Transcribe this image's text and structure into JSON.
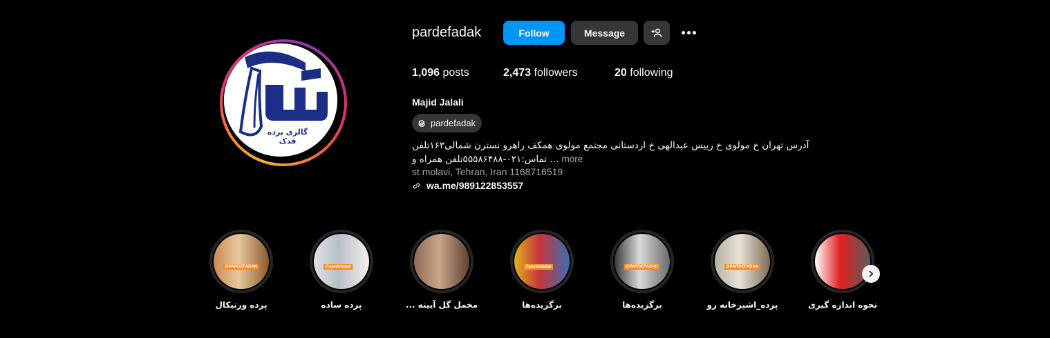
{
  "profile": {
    "username": "pardefadak",
    "logo_caption": "گالری پرده فدک",
    "follow_label": "Follow",
    "message_label": "Message",
    "stats": {
      "posts_count": "1,096",
      "posts_label": "posts",
      "followers_count": "2,473",
      "followers_label": "followers",
      "following_count": "20",
      "following_label": "following"
    },
    "full_name": "Majid Jalali",
    "threads_handle": "pardefadak",
    "bio_line1": "آدرس تهران خ مولوی خ رییس عبدالهی خ اردستانی مجتمع مولوی همکف راهرو نسترن شمالی۱۶۳تلفن",
    "bio_line2": "تماس:۰۲۱-۵۵۵۸۶۴۸۸تلفن همراه و ...",
    "more_label": "more",
    "address": "st molavi, Tehran, Iran 1168716519",
    "link": "wa.me/989122853557"
  },
  "highlights": [
    {
      "label": "پرده ورتیکال",
      "tag": "@PARDEFADAK",
      "colors": [
        "#c98a4e",
        "#e7c9a1",
        "#8b5a2b"
      ]
    },
    {
      "label": "پرده ساده",
      "tag": "@pardefadak",
      "colors": [
        "#dfe3e8",
        "#b8bec6",
        "#f4f1ea"
      ]
    },
    {
      "label": "مخمل گل آیینه ...",
      "tag": "",
      "colors": [
        "#8d6a55",
        "#c9a58a",
        "#5e4233"
      ]
    },
    {
      "label": "برگزیده‌ها",
      "tag": "@pardefadak",
      "colors": [
        "#e0b21f",
        "#c8343a",
        "#3b6fb6"
      ]
    },
    {
      "label": "برگزیده‌ها",
      "tag": "@PARDEFADAK",
      "colors": [
        "#3a3a3a",
        "#d9d9d9",
        "#6a6a6a"
      ]
    },
    {
      "label": "پرده_اشپزخانه رو",
      "tag": "@PARDEFADAK",
      "colors": [
        "#b9b2a5",
        "#e8e2d6",
        "#7d6b55"
      ]
    },
    {
      "label": "نحوه اندازه گیری",
      "tag": "",
      "colors": [
        "#ffffff",
        "#e02020",
        "#5a5a5a"
      ]
    }
  ],
  "icons": {
    "add_user": "person-plus-icon",
    "more": "ellipsis-icon",
    "threads": "threads-icon",
    "link": "link-icon",
    "next": "chevron-right-icon"
  },
  "accent_color": "#0095f6"
}
